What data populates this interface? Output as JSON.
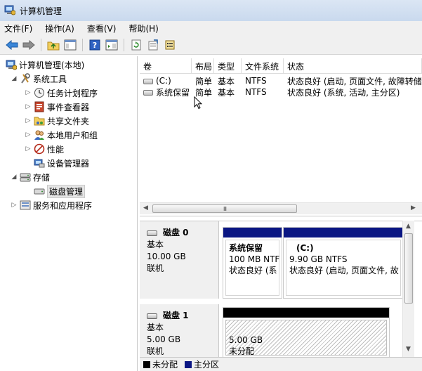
{
  "window": {
    "title": "计算机管理"
  },
  "menu": [
    "文件(F)",
    "操作(A)",
    "查看(V)",
    "帮助(H)"
  ],
  "toolbar": {
    "icons": [
      "back-arrow-icon",
      "forward-arrow-icon",
      "up-folder-icon",
      "show-hide-tree-icon",
      "help-icon",
      "properties-pane-icon",
      "refresh-icon",
      "export-list-icon",
      "properties-icon"
    ]
  },
  "tree": {
    "root": "计算机管理(本地)",
    "system_tools": "系统工具",
    "task_scheduler": "任务计划程序",
    "event_viewer": "事件查看器",
    "shared_folders": "共享文件夹",
    "local_users": "本地用户和组",
    "performance": "性能",
    "device_manager": "设备管理器",
    "storage": "存储",
    "disk_management": "磁盘管理",
    "services": "服务和应用程序"
  },
  "volumes": {
    "headers": [
      "卷",
      "布局",
      "类型",
      "文件系统",
      "状态"
    ],
    "rows": [
      {
        "volume": "(C:)",
        "layout": "简单",
        "type": "基本",
        "fs": "NTFS",
        "status": "状态良好 (启动, 页面文件, 故障转储"
      },
      {
        "volume": "系统保留",
        "layout": "简单",
        "type": "基本",
        "fs": "NTFS",
        "status": "状态良好 (系统, 活动, 主分区)"
      }
    ],
    "scroll_grip": "III"
  },
  "disks": [
    {
      "name": "磁盘 0",
      "type": "基本",
      "size": "10.00 GB",
      "status": "联机",
      "partitions": [
        {
          "title": "系统保留",
          "size": "100 MB NTF",
          "status": "状态良好 (系"
        },
        {
          "title": "(C:)",
          "size": "9.90 GB NTFS",
          "status": "状态良好 (启动, 页面文件, 故"
        }
      ]
    },
    {
      "name": "磁盘 1",
      "type": "基本",
      "size": "5.00 GB",
      "status": "联机",
      "partitions": [
        {
          "size": "5.00 GB",
          "status": "未分配"
        }
      ]
    }
  ],
  "legend": {
    "unallocated": "未分配",
    "primary": "主分区",
    "unallocated_color": "#000000",
    "primary_color": "#0a1683"
  }
}
